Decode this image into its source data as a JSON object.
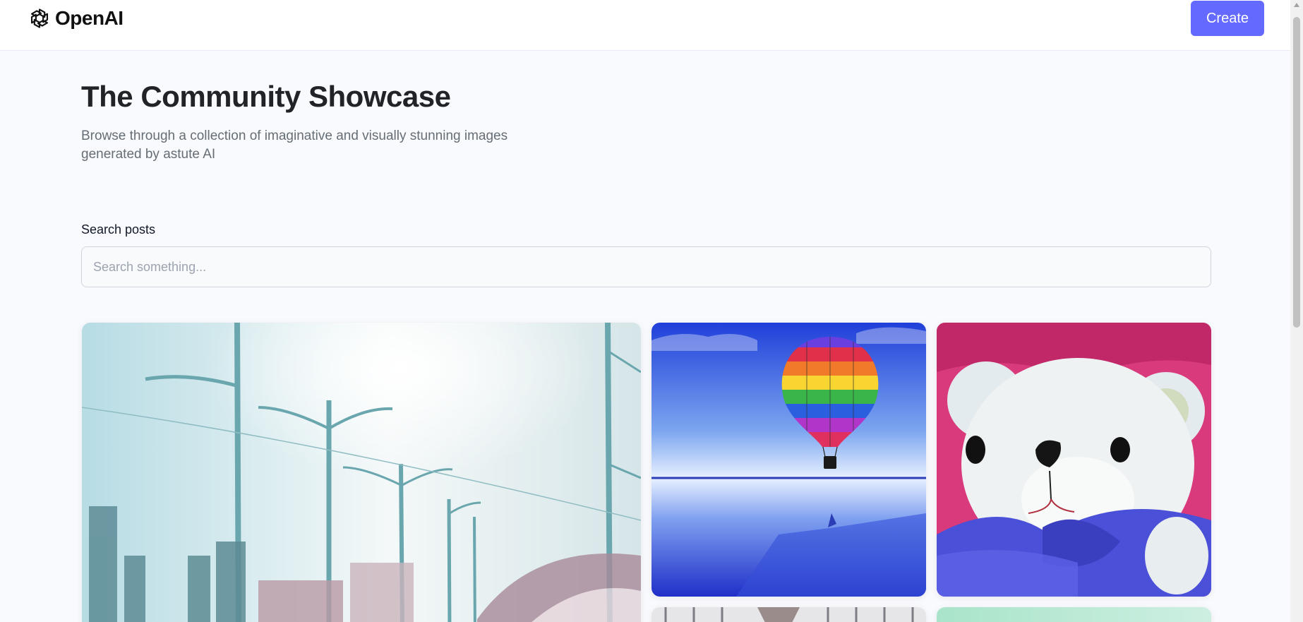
{
  "header": {
    "logo_text": "OpenAI",
    "create_label": "Create",
    "accent_color": "#6469ff"
  },
  "main": {
    "title": "The Community Showcase",
    "subtitle": "Browse through a collection of imaginative and visually stunning images generated by astute AI"
  },
  "search": {
    "label": "Search posts",
    "placeholder": "Search something...",
    "value": ""
  },
  "gallery": {
    "cards": [
      {
        "subject": "city street with lamp posts and sun glare"
      },
      {
        "subject": "rainbow hot air balloon over reflective water"
      },
      {
        "subject": "white teddy bear with blue bow on pink fabric"
      },
      {
        "subject": "balcony railing partially visible"
      },
      {
        "subject": "mint green gradient partially visible"
      }
    ]
  }
}
